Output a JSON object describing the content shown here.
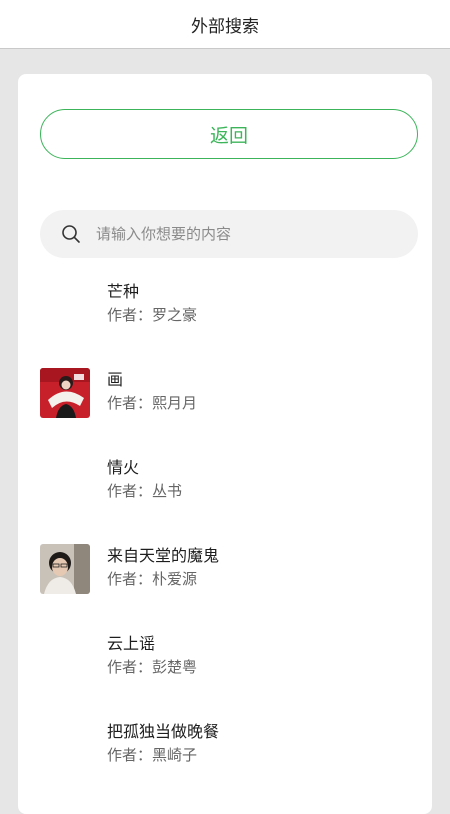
{
  "header": {
    "title": "外部搜索"
  },
  "back_button": {
    "label": "返回"
  },
  "search": {
    "placeholder": "请输入你想要的内容",
    "value": ""
  },
  "author_prefix": "作者：",
  "results": [
    {
      "title": "芒种",
      "author": "作者：罗之豪",
      "has_cover": false
    },
    {
      "title": "画",
      "author": "作者：熙月月",
      "has_cover": true,
      "cover": "woman-with-fan-red-background"
    },
    {
      "title": "情火",
      "author": "作者：丛书",
      "has_cover": false
    },
    {
      "title": "来自天堂的魔鬼",
      "author": "作者：朴爱源",
      "has_cover": true,
      "cover": "man-with-glasses-portrait"
    },
    {
      "title": "云上谣",
      "author": "作者：彭楚粤",
      "has_cover": false
    },
    {
      "title": "把孤独当做晚餐",
      "author": "作者：黑崎子",
      "has_cover": false
    }
  ],
  "colors": {
    "accent": "#3cb55a",
    "background": "#e6e6e6",
    "card": "#ffffff",
    "search_bg": "#f2f2f2"
  }
}
